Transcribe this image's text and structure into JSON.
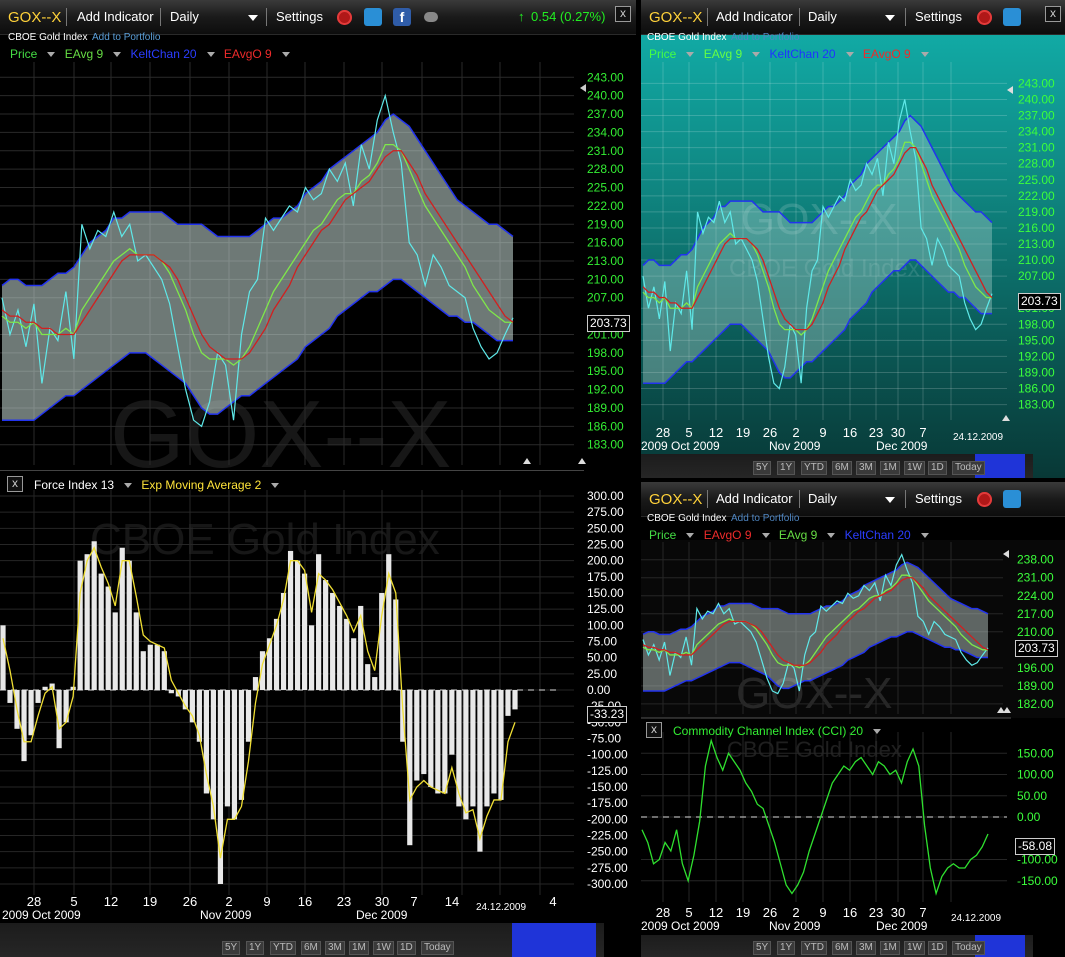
{
  "panels": {
    "main": {
      "symbol": "GOX--X",
      "add_indicator": "Add Indicator",
      "interval": "Daily",
      "settings": "Settings",
      "change": "0.54 (0.27%)",
      "name": "CBOE Gold Index",
      "add_portfolio": "Add to Portfolio",
      "legend": [
        "Price",
        "EAvg 9",
        "KeltChan 20",
        "EAvgO 9"
      ],
      "legend_colors": [
        "#44dd44",
        "#66dd44",
        "#2233ee",
        "#dd2222"
      ],
      "price_ticks": [
        "243.00",
        "240.00",
        "237.00",
        "234.00",
        "231.00",
        "228.00",
        "225.00",
        "222.00",
        "219.00",
        "216.00",
        "213.00",
        "210.00",
        "207.00",
        "201.00",
        "198.00",
        "195.00",
        "192.00",
        "189.00",
        "186.00",
        "183.00"
      ],
      "last_price": "203.73",
      "watermark_symbol": "GOX--X",
      "watermark_name": "CBOE Gold Index",
      "indicator_legend": [
        "Force Index 13",
        "Exp Moving Average 2"
      ],
      "force_ticks": [
        "300.00",
        "275.00",
        "250.00",
        "225.00",
        "200.00",
        "175.00",
        "150.00",
        "125.00",
        "100.00",
        "75.00",
        "50.00",
        "25.00",
        "0.00",
        "-25.00",
        "-50.00",
        "-75.00",
        "-100.00",
        "-125.00",
        "-150.00",
        "-175.00",
        "-200.00",
        "-225.00",
        "-250.00",
        "-275.00",
        "-300.00"
      ],
      "force_last": "-33.23",
      "x_days": [
        "28",
        "5",
        "12",
        "19",
        "26",
        "2",
        "9",
        "16",
        "23",
        "30",
        "7",
        "14",
        "4"
      ],
      "x_months": [
        "2009 Oct 2009",
        "Nov 2009",
        "Dec 2009"
      ],
      "date_stamp": "24.12.2009",
      "ranges": [
        "5Y",
        "1Y",
        "YTD",
        "6M",
        "3M",
        "1M",
        "1W",
        "1D",
        "Today"
      ]
    },
    "top_right": {
      "symbol": "GOX--X",
      "add_indicator": "Add Indicator",
      "interval": "Daily",
      "settings": "Settings",
      "name": "CBOE Gold Index",
      "add_portfolio": "Add to Portfolio",
      "legend": [
        "Price",
        "EAvg 9",
        "KeltChan 20",
        "EAvgO 9"
      ],
      "price_ticks": [
        "243.00",
        "240.00",
        "237.00",
        "234.00",
        "231.00",
        "228.00",
        "225.00",
        "222.00",
        "219.00",
        "216.00",
        "213.00",
        "210.00",
        "207.00",
        "201.00",
        "198.00",
        "195.00",
        "192.00",
        "189.00",
        "186.00",
        "183.00"
      ],
      "last_price": "203.73",
      "watermark_symbol": "GOX--X",
      "watermark_name": "CBOE Gold Index",
      "x_days": [
        "28",
        "5",
        "12",
        "19",
        "26",
        "2",
        "9",
        "16",
        "23",
        "30",
        "7"
      ],
      "x_months": [
        "2009 Oct 2009",
        "Nov 2009",
        "Dec 2009"
      ],
      "date_stamp": "24.12.2009",
      "ranges": [
        "5Y",
        "1Y",
        "YTD",
        "6M",
        "3M",
        "1M",
        "1W",
        "1D",
        "Today"
      ]
    },
    "bottom_right": {
      "symbol": "GOX--X",
      "add_indicator": "Add Indicator",
      "interval": "Daily",
      "settings": "Settings",
      "name": "CBOE Gold Index",
      "add_portfolio": "Add to Portfolio",
      "legend": [
        "Price",
        "EAvgO 9",
        "EAvg 9",
        "KeltChan 20"
      ],
      "legend_colors": [
        "#44dd44",
        "#dd2222",
        "#66dd44",
        "#2233ee"
      ],
      "price_ticks": [
        "238.00",
        "231.00",
        "224.00",
        "217.00",
        "210.00",
        "196.00",
        "189.00",
        "182.00"
      ],
      "last_price": "203.73",
      "watermark_symbol": "GOX--X",
      "watermark_name": "CBOE Gold Index",
      "indicator_legend": "Commodity Channel Index (CCI) 20",
      "cci_ticks": [
        "150.00",
        "100.00",
        "50.00",
        "0.00",
        "-100.00",
        "-150.00"
      ],
      "cci_last": "-58.08",
      "x_days": [
        "28",
        "5",
        "12",
        "19",
        "26",
        "2",
        "9",
        "16",
        "23",
        "30",
        "7"
      ],
      "x_months": [
        "2009 Oct 2009",
        "Nov 2009",
        "Dec 2009"
      ],
      "date_stamp": "24.12.2009",
      "ranges": [
        "5Y",
        "1Y",
        "YTD",
        "6M",
        "3M",
        "1M",
        "1W",
        "1D",
        "Today"
      ]
    }
  },
  "chart_data": [
    {
      "type": "line",
      "title": "GOX--X",
      "xlabel": "",
      "ylabel": "",
      "ylim": [
        183,
        243
      ],
      "series": [
        {
          "name": "Price",
          "values": [
            207,
            201,
            205,
            199,
            206,
            193,
            202,
            200,
            208,
            197,
            219,
            215,
            218,
            217,
            221,
            217,
            219,
            213,
            214,
            212,
            210,
            206,
            199,
            192,
            187,
            186,
            190,
            198,
            196,
            187,
            201,
            208,
            210,
            220,
            218,
            220,
            222,
            221,
            225,
            223,
            224,
            228,
            226,
            229,
            222,
            232,
            228,
            236,
            240,
            234,
            229,
            216,
            214,
            209,
            214,
            212,
            209,
            208,
            207,
            202,
            199,
            197,
            198,
            201,
            203.73
          ]
        },
        {
          "name": "EAvg 9",
          "values": [
            204,
            203,
            203,
            202,
            203,
            201,
            201,
            201,
            202,
            201,
            205,
            207,
            209,
            211,
            213,
            214,
            215,
            214,
            214,
            214,
            213,
            211,
            208,
            205,
            201,
            198,
            197,
            197,
            197,
            196,
            197,
            199,
            202,
            205,
            208,
            210,
            212,
            214,
            216,
            218,
            219,
            221,
            223,
            224,
            224,
            226,
            227,
            229,
            232,
            232,
            231,
            228,
            225,
            222,
            220,
            218,
            216,
            214,
            212,
            209,
            207,
            205,
            204,
            203,
            203
          ]
        },
        {
          "name": "EAvgO 9",
          "values": [
            205,
            204,
            204,
            203,
            203,
            202,
            202,
            201,
            201,
            201,
            203,
            205,
            207,
            209,
            211,
            213,
            214,
            214,
            214,
            214,
            213,
            212,
            210,
            207,
            204,
            201,
            199,
            198,
            197,
            197,
            197,
            198,
            200,
            202,
            205,
            207,
            209,
            212,
            214,
            216,
            218,
            219,
            221,
            223,
            224,
            225,
            226,
            228,
            230,
            231,
            231,
            229,
            227,
            224,
            222,
            220,
            218,
            216,
            214,
            212,
            210,
            208,
            206,
            204,
            203
          ]
        },
        {
          "name": "KeltChan 20 Upper",
          "values": [
            209,
            210,
            210,
            209,
            209,
            209,
            210,
            211,
            211,
            212,
            214,
            216,
            217,
            218,
            220,
            220,
            221,
            221,
            221,
            221,
            221,
            220,
            219,
            219,
            219,
            219,
            218,
            217,
            217,
            217,
            217,
            217,
            218,
            219,
            220,
            220,
            221,
            222,
            224,
            225,
            226,
            228,
            229,
            230,
            231,
            232,
            233,
            234,
            236,
            237,
            236,
            235,
            233,
            231,
            229,
            227,
            225,
            223,
            222,
            221,
            220,
            219,
            219,
            218,
            217
          ]
        },
        {
          "name": "KeltChan 20 Lower",
          "values": [
            187,
            187,
            187,
            187,
            187,
            188,
            189,
            190,
            191,
            191,
            192,
            193,
            194,
            195,
            196,
            197,
            198,
            198,
            198,
            197,
            196,
            195,
            194,
            193,
            191,
            189,
            188,
            188,
            189,
            190,
            191,
            191,
            192,
            193,
            194,
            195,
            196,
            197,
            199,
            200,
            201,
            202,
            204,
            205,
            206,
            207,
            208,
            208,
            209,
            210,
            210,
            209,
            208,
            207,
            206,
            205,
            204,
            204,
            203,
            203,
            202,
            201,
            200,
            200,
            200
          ]
        }
      ]
    },
    {
      "type": "bar",
      "title": "Force Index 13",
      "ylim": [
        -300,
        300
      ],
      "series": [
        {
          "name": "Force Index 13",
          "values": [
            100,
            -20,
            -60,
            -110,
            -70,
            -20,
            5,
            10,
            -90,
            -50,
            5,
            200,
            210,
            230,
            180,
            160,
            120,
            220,
            200,
            120,
            60,
            70,
            70,
            60,
            -5,
            -10,
            -30,
            -50,
            -80,
            -160,
            -200,
            -300,
            -180,
            -200,
            -170,
            -80,
            20,
            60,
            80,
            110,
            150,
            215,
            200,
            180,
            100,
            210,
            170,
            150,
            130,
            110,
            80,
            130,
            40,
            20,
            150,
            210,
            140,
            -80,
            -240,
            -140,
            -130,
            -150,
            -160,
            -160,
            -100,
            -180,
            -200,
            -180,
            -250,
            -180,
            -160,
            -170,
            -40,
            -30
          ]
        },
        {
          "name": "Exp Moving Average 2",
          "values": [
            80,
            30,
            -30,
            -80,
            -80,
            -40,
            -5,
            5,
            -60,
            -50,
            -10,
            150,
            200,
            220,
            190,
            165,
            130,
            200,
            200,
            145,
            85,
            75,
            70,
            65,
            15,
            -5,
            -25,
            -40,
            -70,
            -130,
            -180,
            -260,
            -200,
            -200,
            -180,
            -110,
            -20,
            40,
            70,
            100,
            140,
            200,
            200,
            185,
            120,
            180,
            170,
            155,
            135,
            115,
            90,
            115,
            60,
            30,
            115,
            180,
            150,
            -30,
            -170,
            -150,
            -140,
            -150,
            -155,
            -160,
            -120,
            -160,
            -190,
            -185,
            -230,
            -195,
            -170,
            -170,
            -80,
            -50
          ]
        }
      ]
    },
    {
      "type": "line",
      "title": "Commodity Channel Index (CCI) 20",
      "ylim": [
        -200,
        200
      ],
      "series": [
        {
          "name": "Commodity Channel Index (CCI) 20",
          "values": [
            -30,
            -60,
            -110,
            -100,
            -60,
            -80,
            -30,
            -110,
            -150,
            -90,
            -10,
            120,
            180,
            140,
            110,
            150,
            130,
            110,
            80,
            60,
            30,
            20,
            -20,
            -60,
            -110,
            -160,
            -180,
            -160,
            -130,
            -80,
            -40,
            0,
            40,
            80,
            100,
            120,
            110,
            130,
            140,
            120,
            100,
            130,
            120,
            100,
            110,
            80,
            130,
            160,
            120,
            -20,
            -120,
            -180,
            -140,
            -120,
            -110,
            -120,
            -120,
            -100,
            -90,
            -70,
            -40
          ]
        }
      ]
    }
  ]
}
